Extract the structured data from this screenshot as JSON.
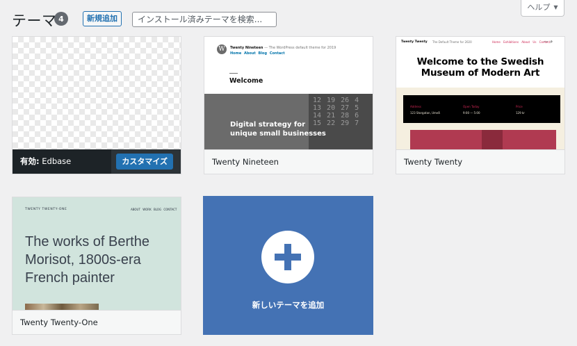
{
  "header": {
    "title": "テーマ",
    "count": "4",
    "add_new_label": "新規追加",
    "search_placeholder": "インストール済みテーマを検索...",
    "help_label": "ヘルプ"
  },
  "themes": [
    {
      "name": "Edbase",
      "active": true,
      "active_prefix": "有効:",
      "customize_label": "カスタマイズ"
    },
    {
      "name": "Twenty Nineteen",
      "preview": {
        "site_title": "Twenty Nineteen",
        "tagline": "— The WordPress default theme for 2019",
        "nav": "Home About Blog Contact",
        "heading": "Welcome",
        "hero_line1": "Digital strategy for",
        "hero_line2": "unique small businesses",
        "calendar_text": "12 19 26 4 13 20 27 5 14 21 28 6 15 22 29 7"
      }
    },
    {
      "name": "Twenty Twenty",
      "preview": {
        "site_title": "Twenty Twenty",
        "description": "The Default Theme for 2020",
        "menu": "Home Exhibitions About Us Contact",
        "headline_line1": "Welcome to the Swedish",
        "headline_line2": "Museum of Modern Art",
        "address_label": "Address",
        "address": "123 Storgatan, Umeå",
        "hours_label": "Open Today",
        "hours": "9:00 — 5:00",
        "price_label": "Price",
        "price": "129 kr"
      }
    },
    {
      "name": "Twenty Twenty-One",
      "preview": {
        "site_title": "TWENTY TWENTY-ONE",
        "nav": "ABOUT WORK BLOG CONTACT",
        "headline": "The works of Berthe Morisot, 1800s-era French painter"
      }
    }
  ],
  "add_new_theme": {
    "label": "新しいテーマを追加"
  },
  "colors": {
    "accent": "#2271b1",
    "add_card": "#4472b4",
    "active_footer": "#1d2327"
  }
}
